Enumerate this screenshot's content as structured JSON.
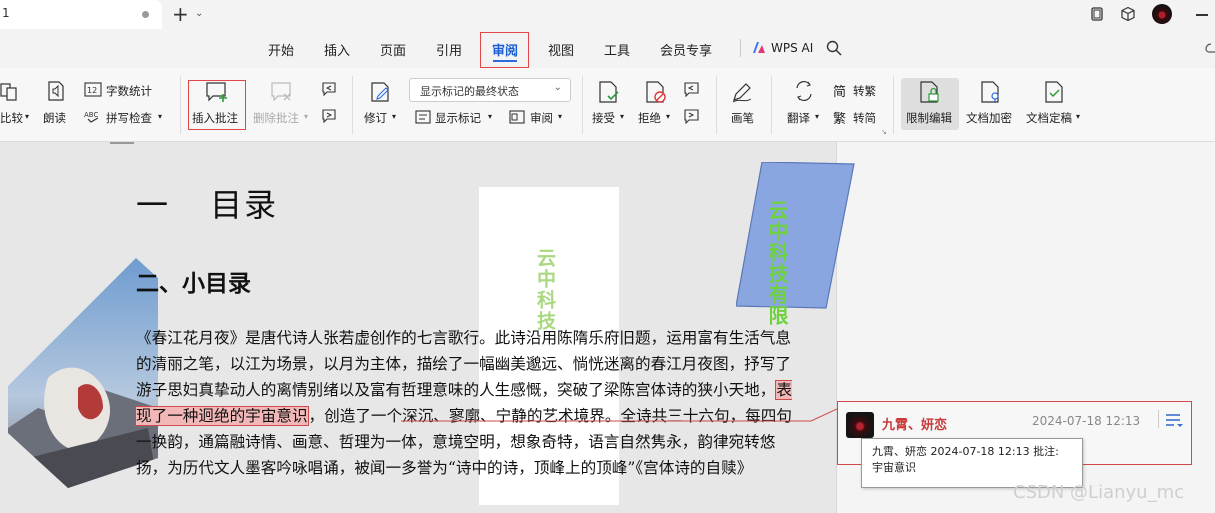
{
  "titlebar": {
    "doc_tab_title": "1",
    "new_tab": "+",
    "tab_menu": "⌄"
  },
  "menu": {
    "items": [
      "开始",
      "插入",
      "页面",
      "引用",
      "审阅",
      "视图",
      "工具",
      "会员专享",
      "WPS AI"
    ],
    "active": "审阅"
  },
  "ribbon": {
    "compare": "比较",
    "read_aloud": "朗读",
    "word_count": "字数统计",
    "spell_check": "拼写检查",
    "insert_comment": "插入批注",
    "delete_comment": "删除批注",
    "revise": "修订",
    "markup_state": "显示标记的最终状态",
    "show_markup": "显示标记",
    "review": "审阅",
    "accept": "接受",
    "reject": "拒绝",
    "pen": "画笔",
    "translate": "翻译",
    "to_traditional": "转繁",
    "to_simplified": "转简",
    "restrict_edit": "限制编辑",
    "doc_encrypt": "文档加密",
    "doc_finalize": "文档定稿"
  },
  "document": {
    "heading1": "一 目录",
    "heading2": "二、小目录",
    "para_before": "《春江花月夜》是唐代诗人张若虚创作的七言歌行。此诗沿用陈隋乐府旧题，运用富有生活气息的清丽之笔，以江为场景，以月为主体，描绘了一幅幽美邈远、惝恍迷离的春江月夜图，抒写了游子思妇真挚动人的离情别绪以及富有哲理意味的人生感慨，突破了梁陈宫体诗的狭小天地，",
    "para_highlight": "表现了一种迥绝的宇宙意识",
    "para_after": "，创造了一个深沉、寥廓、宁静的艺术境界。全诗共三十六句，每四句一换韵，通篇融诗情、画意、哲理为一体，意境空明，想象奇特，语言自然隽永，韵律宛转悠扬，为历代文人墨客吟咏唱诵，被闻一多誉为“诗中的诗，顶峰上的顶峰”《宫体诗的自赎》",
    "watermark_vertical": "云中科技",
    "watermark_box_col1": "云中科",
    "watermark_box_col2": "技有限"
  },
  "comment": {
    "author": "九霄、妍恋",
    "time": "2024-07-18 12:13",
    "tooltip_line1": "九霄、妍恋 2024-07-18 12:13 批注:",
    "tooltip_line2": "宇宙意识"
  },
  "footer_watermark": "CSDN @Lianyu_mc",
  "colors": {
    "accent_red": "#d14a4a",
    "active_tab_blue": "#2d6bdd",
    "watermark_green": "#6ed23e",
    "box_blue": "#8aa6e0"
  }
}
